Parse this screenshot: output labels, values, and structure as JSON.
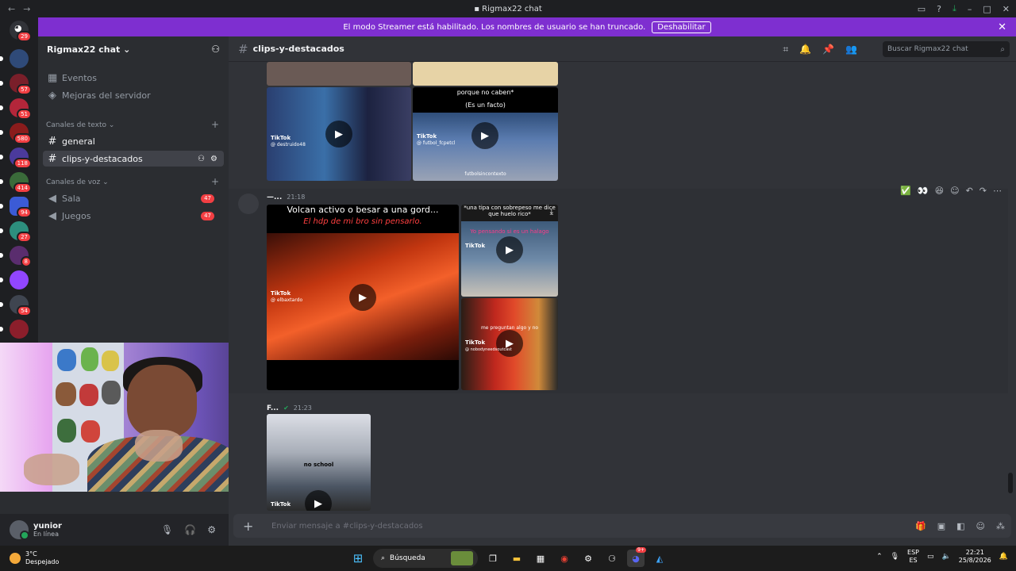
{
  "window": {
    "title": "Rigmax22 chat"
  },
  "banner": {
    "text": "El modo Streamer está habilitado. Los nombres de usuario se han truncado.",
    "button": "Deshabilitar"
  },
  "rail": {
    "home_badge": "29",
    "servers": [
      {
        "badge": "",
        "color": "#2f4a78"
      },
      {
        "badge": "57",
        "color": "#7a1f2a"
      },
      {
        "badge": "51",
        "color": "#b3263a"
      },
      {
        "badge": "580",
        "color": "#8a1c1c"
      },
      {
        "badge": "118",
        "color": "#4b3a9c"
      },
      {
        "badge": "414",
        "color": "#3a6b3a"
      },
      {
        "badge": "94",
        "color": "#3b5bd6"
      },
      {
        "badge": "27",
        "color": "#2d8f7e"
      },
      {
        "badge": "8",
        "color": "#5a2d6e"
      },
      {
        "badge": "",
        "color": "#9146ff"
      },
      {
        "badge": "54",
        "color": "#3f4550"
      },
      {
        "badge": "",
        "color": "#8b1e2b"
      }
    ]
  },
  "sidebar": {
    "server_name": "Rigmax22 chat",
    "top_items": [
      "Eventos",
      "Mejoras del servidor"
    ],
    "text_category": "Canales de texto",
    "text_channels": [
      "general",
      "clips-y-destacados"
    ],
    "voice_category": "Canales de voz",
    "voice_channels": [
      {
        "name": "Sala",
        "count": "47"
      },
      {
        "name": "Juegos",
        "count": "47"
      }
    ]
  },
  "user": {
    "name": "yunior",
    "status": "En línea"
  },
  "channel": {
    "name": "clips-y-destacados",
    "search_placeholder": "Buscar Rigmax22 chat"
  },
  "messages": {
    "m1": {
      "caption_top": "porque no caben*",
      "caption_sub": "(Es un facto)",
      "tiktok_a": "TikTok",
      "handle_a": "@ destruido48",
      "tiktok_b": "TikTok",
      "handle_b": "@ futbol_fcpetcl",
      "sin_contexto": "futbolsincontexto"
    },
    "m2": {
      "author": "—...",
      "time": "21:18",
      "clip1_title": "Volcan activo o besar a una gord...",
      "clip1_caption": "El hdp de mi bro sin pensarlo.",
      "clip1_tiktok": "TikTok",
      "clip1_handle": "@ elbaxtardo",
      "clip2_title": "*una tipa con sobrepeso me dice que huelo rico*",
      "clip2_caption": "Yo pensando si es un halago",
      "clip2_tiktok": "TikTok",
      "clip3_caption": "me preguntan algo y no",
      "clip3_tiktok": "TikTok",
      "clip3_handle": "@ nobodyneedsoutcast",
      "react_check": "✅",
      "react_eyes": "👀",
      "react_laugh": "😆"
    },
    "m3": {
      "author": "F...",
      "time": "21:23",
      "clip_caption": "no school",
      "clip_tiktok": "TikTok"
    }
  },
  "composer": {
    "placeholder": "Enviar mensaje a #clips-y-destacados"
  },
  "taskbar": {
    "temp": "3°C",
    "weather": "Despejado",
    "search": "Búsqueda",
    "lang_top": "ESP",
    "lang_bottom": "ES",
    "time": "22:21",
    "date": "25/8/2026",
    "discord_badge": "9+"
  },
  "colors": {
    "accent": "#7e2fd0",
    "badge": "#f23f43",
    "online": "#23a55a"
  }
}
